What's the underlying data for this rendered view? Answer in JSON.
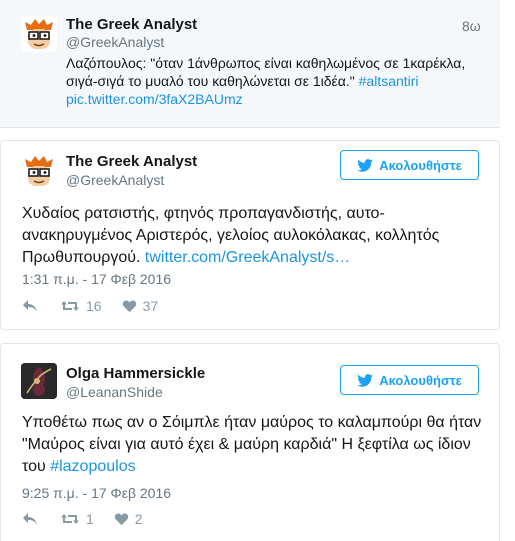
{
  "context_tweet": {
    "name": "The Greek Analyst",
    "handle": "@GreekAnalyst",
    "time": "8ω",
    "text": "Λαζόπουλος: \"όταν 1άνθρωπος είναι καθηλωμένος σε 1καρέκλα, σιγά-σιγά το μυαλό του καθηλώνεται σε 1ιδέα.\" ",
    "hashtag": "#altsantiri",
    "link": "pic.twitter.com/3faX2BAUmz"
  },
  "tweet1": {
    "name": "The Greek Analyst",
    "handle": "@GreekAnalyst",
    "follow_label": "Ακολουθήστε",
    "text": "Χυδαίος ρατσιστής, φτηνός προπαγανδιστής, αυτο-ανακηρυγμένος Αριστερός, γελοίος αυλοκόλακας, κολλητός Πρωθυπουργού. ",
    "link": "twitter.com/GreekAnalyst/s…",
    "timestamp": "1:31 π.μ. - 17 Φεβ 2016",
    "retweets": "16",
    "likes": "37"
  },
  "tweet2": {
    "name": "Olga Hammersickle",
    "handle": "@LeananShide",
    "follow_label": "Ακολουθήστε",
    "text": "Υποθέτω πως αν ο Σόιμπλε ήταν μαύρος το καλαμπούρι θα ήταν \"Μαύρος είναι για αυτό έχει & μαύρη καρδιά\" Η ξεφτίλα ως ίδιον του ",
    "hashtag": "#lazopoulos",
    "timestamp": "9:25 π.μ. - 17 Φεβ 2016",
    "retweets": "1",
    "likes": "2"
  }
}
